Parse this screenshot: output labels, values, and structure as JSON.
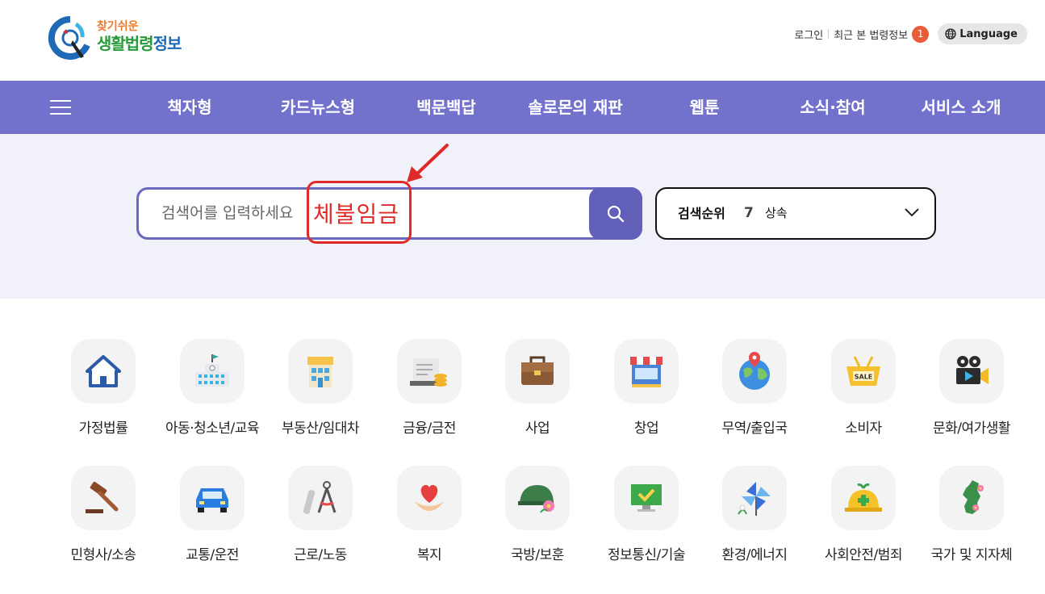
{
  "logo": {
    "small": "찾기쉬운",
    "big_green": "생활법령",
    "big_blue": "정보"
  },
  "util": {
    "login": "로그인",
    "recent": "최근 본 법령정보",
    "recent_count": "1",
    "language": "Language"
  },
  "nav": {
    "menu_icon": "hamburger-icon",
    "items": [
      {
        "label": "책자형"
      },
      {
        "label": "카드뉴스형"
      },
      {
        "label": "백문백답"
      },
      {
        "label": "솔로몬의 재판"
      },
      {
        "label": "웹툰"
      },
      {
        "label": "소식·참여"
      },
      {
        "label": "서비스 소개"
      }
    ]
  },
  "search": {
    "placeholder": "검색어를 입력하세요",
    "annotation_text": "체불임금",
    "icon": "search-icon"
  },
  "rank": {
    "label": "검색순위",
    "number": "7",
    "word": "상속",
    "icon": "chevron-down-icon"
  },
  "categories": [
    {
      "label": "가정법률",
      "icon": "house-icon"
    },
    {
      "label": "아동·청소년/교육",
      "icon": "school-icon"
    },
    {
      "label": "부동산/임대차",
      "icon": "building-icon"
    },
    {
      "label": "금융/금전",
      "icon": "money-icon"
    },
    {
      "label": "사업",
      "icon": "briefcase-icon"
    },
    {
      "label": "창업",
      "icon": "storefront-icon"
    },
    {
      "label": "무역/출입국",
      "icon": "globe-pin-icon"
    },
    {
      "label": "소비자",
      "icon": "sale-basket-icon"
    },
    {
      "label": "문화/여가생활",
      "icon": "movie-camera-icon"
    },
    {
      "label": "민형사/소송",
      "icon": "gavel-icon"
    },
    {
      "label": "교통/운전",
      "icon": "car-icon"
    },
    {
      "label": "근로/노동",
      "icon": "compass-tools-icon"
    },
    {
      "label": "복지",
      "icon": "heart-hands-icon"
    },
    {
      "label": "국방/보훈",
      "icon": "helmet-flower-icon"
    },
    {
      "label": "정보통신/기술",
      "icon": "monitor-check-icon"
    },
    {
      "label": "환경/에너지",
      "icon": "pinwheel-icon"
    },
    {
      "label": "사회안전/범죄",
      "icon": "safety-helmet-icon"
    },
    {
      "label": "국가 및 지자체",
      "icon": "korea-map-icon"
    }
  ],
  "colors": {
    "nav": "#7272cc",
    "search_border": "#6a67bf",
    "annotation": "#e02a2a",
    "badge": "#e75d3a"
  }
}
